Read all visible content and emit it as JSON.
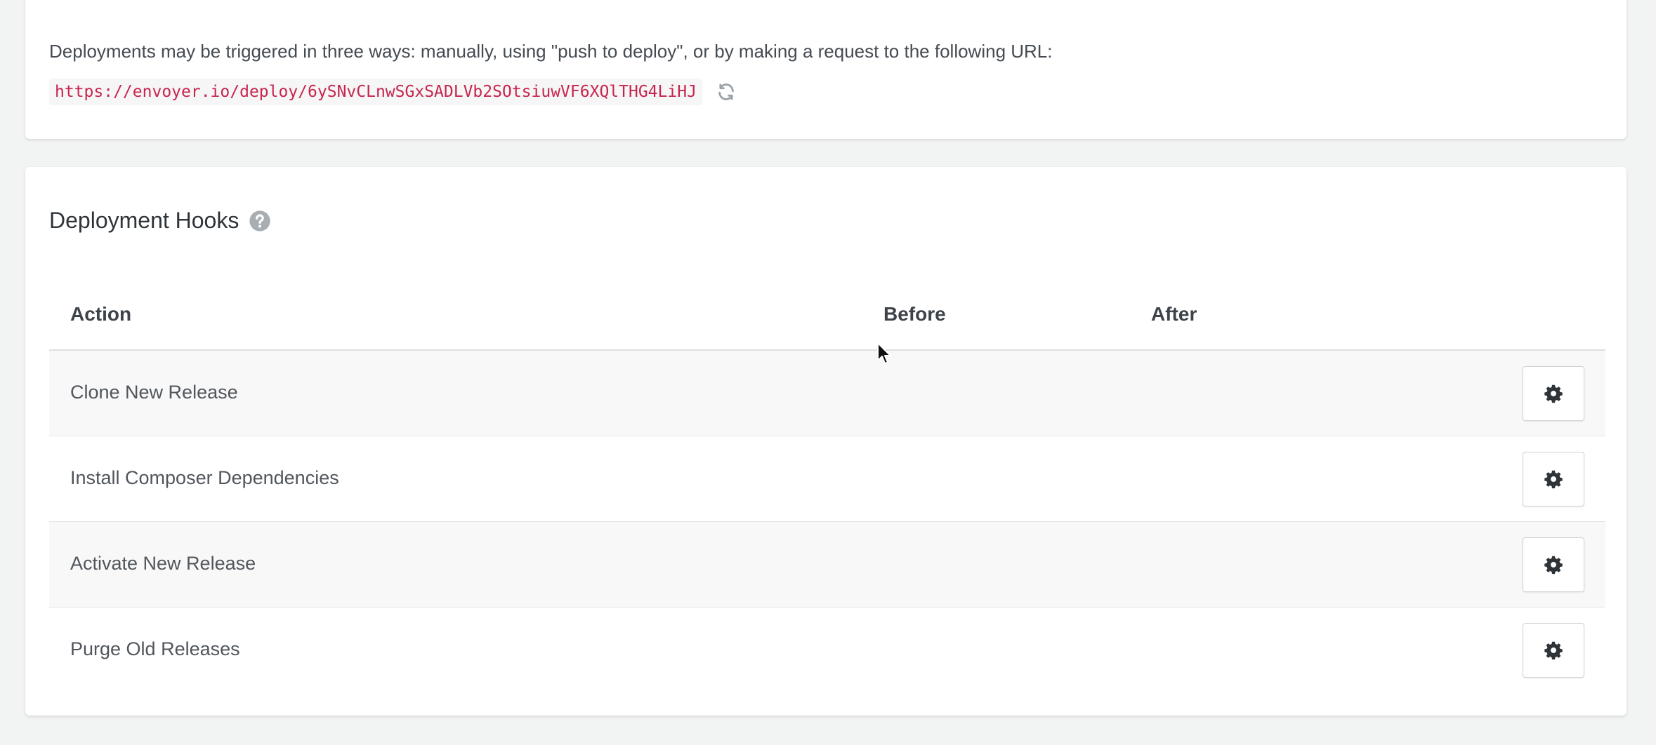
{
  "trigger_panel": {
    "description": "Deployments may be triggered in three ways: manually, using \"push to deploy\", or by making a request to the following URL:",
    "deploy_url": "https://envoyer.io/deploy/6ySNvCLnwSGxSADLVb2SOtsiuwVF6XQlTHG4LiHJ",
    "refresh_icon": "refresh-icon"
  },
  "hooks_panel": {
    "title": "Deployment Hooks",
    "help_icon": "question-circle-icon",
    "columns": {
      "action": "Action",
      "before": "Before",
      "after": "After"
    },
    "rows": [
      {
        "action": "Clone New Release",
        "before": "",
        "after": "",
        "settings_icon": "gear-icon"
      },
      {
        "action": "Install Composer Dependencies",
        "before": "",
        "after": "",
        "settings_icon": "gear-icon"
      },
      {
        "action": "Activate New Release",
        "before": "",
        "after": "",
        "settings_icon": "gear-icon"
      },
      {
        "action": "Purge Old Releases",
        "before": "",
        "after": "",
        "settings_icon": "gear-icon"
      }
    ]
  },
  "colors": {
    "background": "#f2f3f3",
    "panel": "#ffffff",
    "url_text": "#c7254e",
    "row_stripe": "#f8f8f8",
    "icon_gray": "#9ba1a6",
    "gear": "#2f3439"
  }
}
